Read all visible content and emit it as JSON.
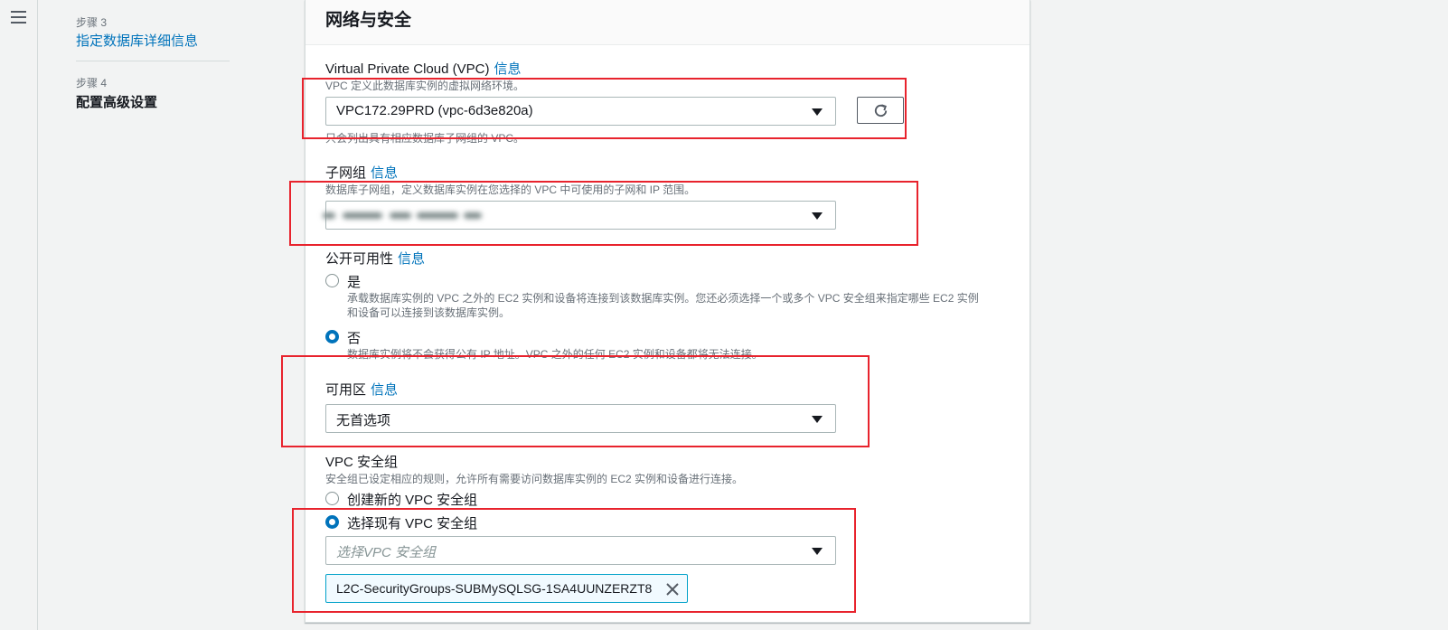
{
  "nav": {
    "steps": [
      {
        "label": "步骤 3",
        "title": "指定数据库详细信息"
      },
      {
        "label": "步骤 4",
        "title": "配置高级设置"
      }
    ]
  },
  "section": {
    "title": "网络与安全"
  },
  "info_link": "信息",
  "vpc": {
    "label": "Virtual Private Cloud (VPC)",
    "description": "VPC 定义此数据库实例的虚拟网络环境。",
    "selected": "VPC172.29PRD (vpc-6d3e820a)",
    "hint": "只会列出具有相应数据库子网组的 VPC。"
  },
  "subnet_group": {
    "label": "子网组",
    "description": "数据库子网组，定义数据库实例在您选择的 VPC 中可使用的子网和 IP 范围。"
  },
  "public_access": {
    "label": "公开可用性",
    "options": [
      {
        "label": "是",
        "description_line1": "承载数据库实例的 VPC 之外的 EC2 实例和设备将连接到该数据库实例。您还必须选择一个或多个 VPC 安全组来指定哪些 EC2 实例",
        "description_line2": "和设备可以连接到该数据库实例。",
        "checked": false
      },
      {
        "label": "否",
        "description_line1": "数据库实例将不会获得公有 IP 地址。VPC 之外的任何 EC2 实例和设备都将无法连接。",
        "checked": true
      }
    ]
  },
  "availability_zone": {
    "label": "可用区",
    "selected": "无首选项"
  },
  "security_group": {
    "label": "VPC 安全组",
    "description": "安全组已设定相应的规则，允许所有需要访问数据库实例的 EC2 实例和设备进行连接。",
    "options": [
      {
        "label": "创建新的 VPC 安全组",
        "checked": false
      },
      {
        "label": "选择现有 VPC 安全组",
        "checked": true
      }
    ],
    "placeholder": "选择VPC 安全组",
    "tokens": [
      "L2C-SecurityGroups-SUBMySQLSG-1SA4UUNZERZT8"
    ]
  },
  "colors": {
    "accent": "#0073bb",
    "annotation": "#e8232d",
    "token_border": "#00a1c9"
  },
  "icons": [
    "menu-icon",
    "refresh-icon",
    "caret-down-icon",
    "close-icon"
  ]
}
